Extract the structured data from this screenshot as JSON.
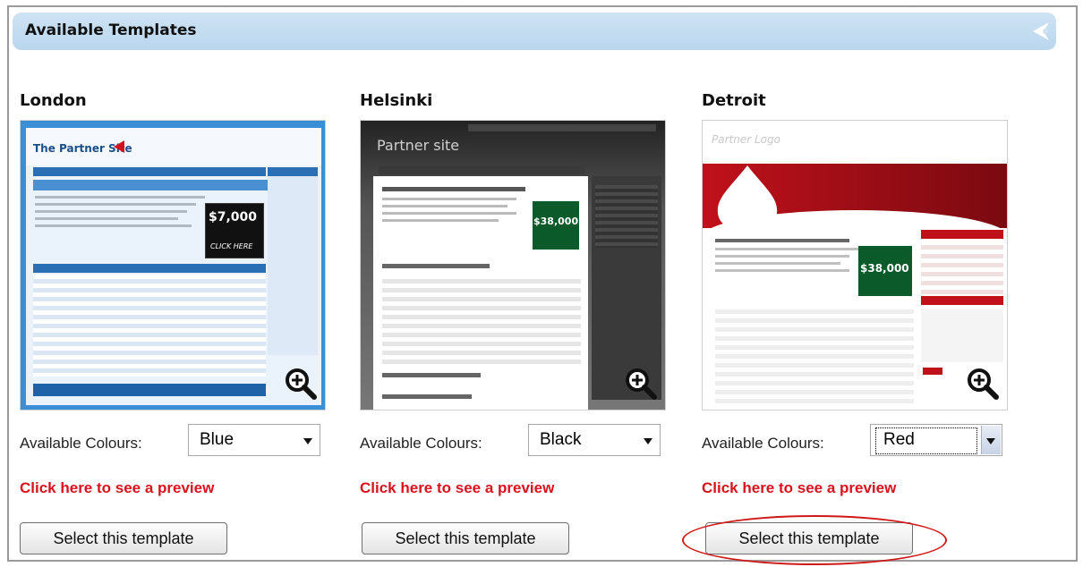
{
  "header": {
    "title": "Available Templates",
    "icon": "arrow-left-icon"
  },
  "templates": [
    {
      "name": "London",
      "colours_label": "Available Colours:",
      "colour": "Blue",
      "preview_link": "Click here to see a preview",
      "select_label": "Select this template",
      "accent": "#2a7bc4",
      "thumb": {
        "site_title": "The Partner Site",
        "promo_amount": "$7,000",
        "promo_text": "CLICK HERE"
      }
    },
    {
      "name": "Helsinki",
      "colours_label": "Available Colours:",
      "colour": "Black",
      "preview_link": "Click here to see a preview",
      "select_label": "Select this template",
      "accent": "#333333",
      "thumb": {
        "site_title": "Partner site",
        "promo_amount": "$38,000"
      }
    },
    {
      "name": "Detroit",
      "colours_label": "Available Colours:",
      "colour": "Red",
      "preview_link": "Click here to see a preview",
      "select_label": "Select this template",
      "accent": "#c0111b",
      "thumb": {
        "site_title": "Partner Logo",
        "promo_amount": "$38,000"
      }
    }
  ],
  "zoom_icon": "zoom-in-icon"
}
